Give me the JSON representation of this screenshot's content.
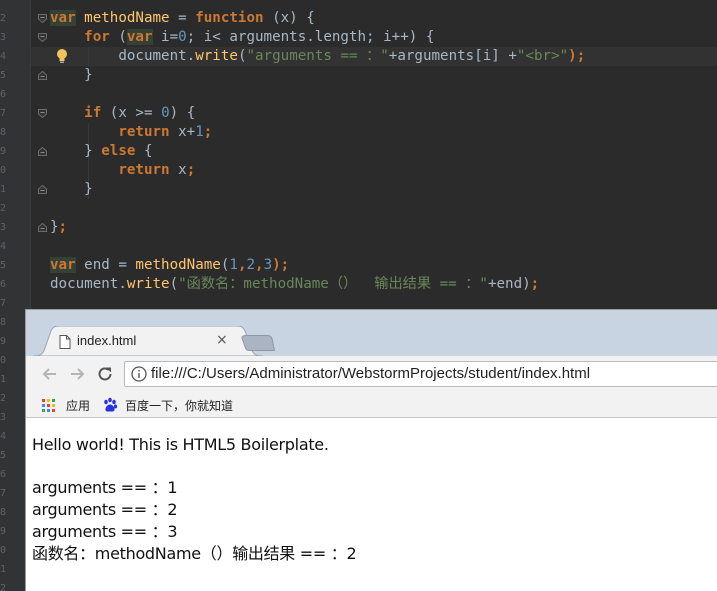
{
  "editor": {
    "code_lines": [
      {
        "tokens": [
          {
            "t": "var",
            "c": "kv"
          },
          {
            "t": " ",
            "c": "pl"
          },
          {
            "t": "methodName",
            "c": "fn"
          },
          {
            "t": " = ",
            "c": "pl"
          },
          {
            "t": "function",
            "c": "k"
          },
          {
            "t": " (x) {",
            "c": "pl"
          }
        ]
      },
      {
        "tokens": [
          {
            "t": "    ",
            "c": "pl"
          },
          {
            "t": "for",
            "c": "k"
          },
          {
            "t": " (",
            "c": "pl"
          },
          {
            "t": "var",
            "c": "kv"
          },
          {
            "t": " i=",
            "c": "pl"
          },
          {
            "t": "0",
            "c": "num"
          },
          {
            "t": "; i< arguments.length; i++) {",
            "c": "pl"
          }
        ]
      },
      {
        "tokens": [
          {
            "t": "        document.",
            "c": "pl"
          },
          {
            "t": "write",
            "c": "fn"
          },
          {
            "t": "(",
            "c": "pl"
          },
          {
            "t": "\"arguments == ：\"",
            "c": "str"
          },
          {
            "t": "+arguments[i] +",
            "c": "pl"
          },
          {
            "t": "\"<br>\"",
            "c": "str"
          },
          {
            "t": ");",
            "c": "k"
          }
        ]
      },
      {
        "tokens": [
          {
            "t": "    }",
            "c": "pl"
          }
        ]
      },
      {
        "tokens": []
      },
      {
        "tokens": [
          {
            "t": "    ",
            "c": "pl"
          },
          {
            "t": "if",
            "c": "k"
          },
          {
            "t": " (x >= ",
            "c": "pl"
          },
          {
            "t": "0",
            "c": "num"
          },
          {
            "t": ") {",
            "c": "pl"
          }
        ]
      },
      {
        "tokens": [
          {
            "t": "        ",
            "c": "pl"
          },
          {
            "t": "return",
            "c": "k"
          },
          {
            "t": " x+",
            "c": "pl"
          },
          {
            "t": "1",
            "c": "num"
          },
          {
            "t": ";",
            "c": "k"
          }
        ]
      },
      {
        "tokens": [
          {
            "t": "    } ",
            "c": "pl"
          },
          {
            "t": "else",
            "c": "k"
          },
          {
            "t": " {",
            "c": "pl"
          }
        ]
      },
      {
        "tokens": [
          {
            "t": "        ",
            "c": "pl"
          },
          {
            "t": "return",
            "c": "k"
          },
          {
            "t": " x",
            "c": "pl"
          },
          {
            "t": ";",
            "c": "k"
          }
        ]
      },
      {
        "tokens": [
          {
            "t": "    }",
            "c": "pl"
          }
        ]
      },
      {
        "tokens": []
      },
      {
        "tokens": [
          {
            "t": "}",
            "c": "pl"
          },
          {
            "t": ";",
            "c": "k"
          }
        ]
      },
      {
        "tokens": []
      },
      {
        "tokens": [
          {
            "t": "var",
            "c": "kv"
          },
          {
            "t": " end = ",
            "c": "pl"
          },
          {
            "t": "methodName",
            "c": "fn"
          },
          {
            "t": "(",
            "c": "pl"
          },
          {
            "t": "1",
            "c": "num"
          },
          {
            "t": ",",
            "c": "k"
          },
          {
            "t": "2",
            "c": "num"
          },
          {
            "t": ",",
            "c": "k"
          },
          {
            "t": "3",
            "c": "num"
          },
          {
            "t": ");",
            "c": "k"
          }
        ]
      },
      {
        "tokens": [
          {
            "t": "document.",
            "c": "pl"
          },
          {
            "t": "write",
            "c": "fn"
          },
          {
            "t": "(",
            "c": "pl"
          },
          {
            "t": "\"函数名：methodName（）  输出结果 == ：\"",
            "c": "str"
          },
          {
            "t": "+end)",
            "c": "pl"
          },
          {
            "t": ";",
            "c": "k"
          }
        ]
      }
    ],
    "gutter_numbers": [
      "2",
      "3",
      "4",
      "5",
      "6",
      "7",
      "8",
      "9",
      "0",
      "1",
      "2",
      "3",
      "4",
      "5",
      "6",
      "7",
      "8",
      "9",
      "0",
      "1",
      "2",
      "3",
      "4",
      "5",
      "6",
      "7",
      "8",
      "9",
      "0",
      "1",
      "2"
    ],
    "icons": {
      "bulb": "lightbulb-icon",
      "fold": "fold-marker-icon"
    }
  },
  "browser": {
    "tab": {
      "title": "index.html",
      "close": "×"
    },
    "address": {
      "url": "file:///C:/Users/Administrator/WebstormProjects/student/index.html"
    },
    "bookmarks": [
      {
        "label": "应用",
        "icon": "apps-grid-icon"
      },
      {
        "label": "百度一下，你就知道",
        "icon": "baidu-paw-icon"
      }
    ],
    "page": {
      "lines": [
        "Hello world! This is HTML5 Boilerplate.",
        "arguments == ：1",
        "arguments == ：2",
        "arguments == ：3",
        "函数名：methodName（）输出结果 == ：2"
      ]
    }
  },
  "colors": {
    "editor_bg": "#2b2b2b",
    "keyword": "#cc7832",
    "function": "#ffc66d",
    "string": "#6a8759",
    "number": "#6897bb",
    "text": "#a9b7c6",
    "tabstrip": "#c9d4e3"
  }
}
